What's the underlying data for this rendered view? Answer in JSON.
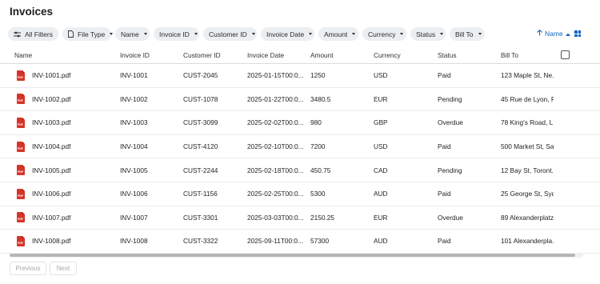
{
  "page": {
    "title": "Invoices"
  },
  "filters": [
    {
      "label": "All Filters",
      "icon": "filter-sliders-icon",
      "caret": false
    },
    {
      "label": "File Type",
      "icon": "file-icon",
      "caret": true
    },
    {
      "label": "Name",
      "caret": true
    },
    {
      "label": "Invoice ID",
      "caret": true
    },
    {
      "label": "Customer ID",
      "caret": true
    },
    {
      "label": "Invoice Date",
      "caret": true
    },
    {
      "label": "Amount",
      "caret": true
    },
    {
      "label": "Currency",
      "caret": true
    },
    {
      "label": "Status",
      "caret": true
    },
    {
      "label": "Bill To",
      "caret": true
    }
  ],
  "sort": {
    "label": "Name",
    "direction_icon": "arrow-up-icon",
    "caret_icon": "caret-up-icon"
  },
  "view_toggle": {
    "icon": "grid-view-icon"
  },
  "table": {
    "columns": [
      "Name",
      "Invoice ID",
      "Customer ID",
      "Invoice Date",
      "Amount",
      "Currency",
      "Status",
      "Bill To"
    ],
    "rows": [
      {
        "name": "INV-1001.pdf",
        "invoice_id": "INV-1001",
        "customer_id": "CUST-2045",
        "date": "2025-01-15T00:0...",
        "amount": "1250",
        "currency": "USD",
        "status": "Paid",
        "bill_to": "123 Maple St, Ne..."
      },
      {
        "name": "INV-1002.pdf",
        "invoice_id": "INV-1002",
        "customer_id": "CUST-1078",
        "date": "2025-01-22T00:0...",
        "amount": "3480.5",
        "currency": "EUR",
        "status": "Pending",
        "bill_to": "45 Rue de Lyon, P..."
      },
      {
        "name": "INV-1003.pdf",
        "invoice_id": "INV-1003",
        "customer_id": "CUST-3099",
        "date": "2025-02-02T00:0...",
        "amount": "980",
        "currency": "GBP",
        "status": "Overdue",
        "bill_to": "78 King's Road, L..."
      },
      {
        "name": "INV-1004.pdf",
        "invoice_id": "INV-1004",
        "customer_id": "CUST-4120",
        "date": "2025-02-10T00:0...",
        "amount": "7200",
        "currency": "USD",
        "status": "Paid",
        "bill_to": "500 Market St, Sa..."
      },
      {
        "name": "INV-1005.pdf",
        "invoice_id": "INV-1005",
        "customer_id": "CUST-2244",
        "date": "2025-02-18T00:0...",
        "amount": "450.75",
        "currency": "CAD",
        "status": "Pending",
        "bill_to": "12 Bay St, Toront..."
      },
      {
        "name": "INV-1006.pdf",
        "invoice_id": "INV-1006",
        "customer_id": "CUST-1156",
        "date": "2025-02-25T00:0...",
        "amount": "5300",
        "currency": "AUD",
        "status": "Paid",
        "bill_to": "25 George St, Syd..."
      },
      {
        "name": "INV-1007.pdf",
        "invoice_id": "INV-1007",
        "customer_id": "CUST-3301",
        "date": "2025-03-03T00:0...",
        "amount": "2150.25",
        "currency": "EUR",
        "status": "Overdue",
        "bill_to": "89 Alexanderplatz..."
      },
      {
        "name": "INV-1008.pdf",
        "invoice_id": "INV-1008",
        "customer_id": "CUST-3322",
        "date": "2025-09-11T00:0...",
        "amount": "57300",
        "currency": "AUD",
        "status": "Paid",
        "bill_to": "101 Alexanderpla..."
      }
    ],
    "file_icon": {
      "name": "pdf-file-icon",
      "badge": "PDF",
      "color": "#d6342b"
    }
  },
  "pagination": {
    "previous": "Previous",
    "next": "Next"
  },
  "colors": {
    "accent": "#1565c0",
    "chip_bg": "#eceff2",
    "pdf_red": "#d6342b"
  }
}
